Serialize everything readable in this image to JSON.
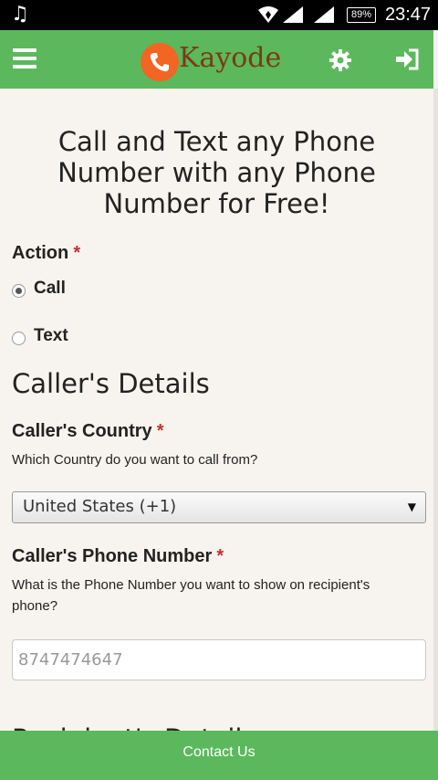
{
  "status_bar": {
    "battery": "89%",
    "time": "23:47"
  },
  "app_bar": {
    "brand": "Kayode"
  },
  "hero": {
    "headline": "Call and Text any Phone Number with any Phone Number for Free!"
  },
  "action": {
    "label": "Action",
    "required_mark": "*",
    "options": [
      {
        "label": "Call",
        "selected": true
      },
      {
        "label": "Text",
        "selected": false
      }
    ]
  },
  "callers_details": {
    "title": "Caller's Details",
    "country": {
      "label": "Caller's Country",
      "required_mark": "*",
      "help": "Which Country do you want to call from?",
      "selected": "United States (+1)"
    },
    "phone": {
      "label": "Caller's Phone Number",
      "required_mark": "*",
      "help": "What is the Phone Number you want to show on recipient's phone?",
      "placeholder": "8747474647"
    }
  },
  "next_section": {
    "title": "Recipient's Details"
  },
  "footer": {
    "contact": "Contact Us"
  },
  "colors": {
    "primary_green": "#5cb85c",
    "logo_orange": "#f26522",
    "brand_brown": "#7b3b12",
    "required_red": "#c9302c",
    "page_background": "#f7f4ef"
  },
  "icons": {
    "status_left": "music-note-icon",
    "status_right": [
      "wifi-icon",
      "cell-signal-icon",
      "cell-signal-icon",
      "battery-icon"
    ],
    "app_bar": [
      "menu-icon",
      "phone-logo-icon",
      "gear-icon",
      "sign-in-icon"
    ]
  }
}
